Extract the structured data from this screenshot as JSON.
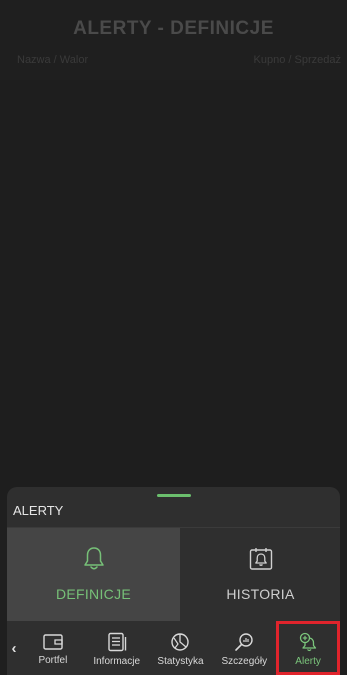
{
  "page": {
    "title": "ALERTY - DEFINICJE",
    "col_left": "Nazwa / Walor",
    "col_right": "Kupno / Sprzedaż"
  },
  "sheet": {
    "title": "ALERTY",
    "tiles": [
      {
        "label": "DEFINICJE",
        "icon": "bell-icon",
        "active": true
      },
      {
        "label": "HISTORIA",
        "icon": "alert-history-icon",
        "active": false
      }
    ]
  },
  "nav": {
    "items": [
      {
        "label": "Portfel",
        "icon": "wallet-icon"
      },
      {
        "label": "Informacje",
        "icon": "news-icon"
      },
      {
        "label": "Statystyka",
        "icon": "statistics-icon"
      },
      {
        "label": "Szczegóły",
        "icon": "details-search-icon"
      },
      {
        "label": "Alerty",
        "icon": "add-alert-icon",
        "active": true
      }
    ]
  },
  "colors": {
    "accent_green": "#77c178",
    "highlight_red": "#e0242c"
  }
}
